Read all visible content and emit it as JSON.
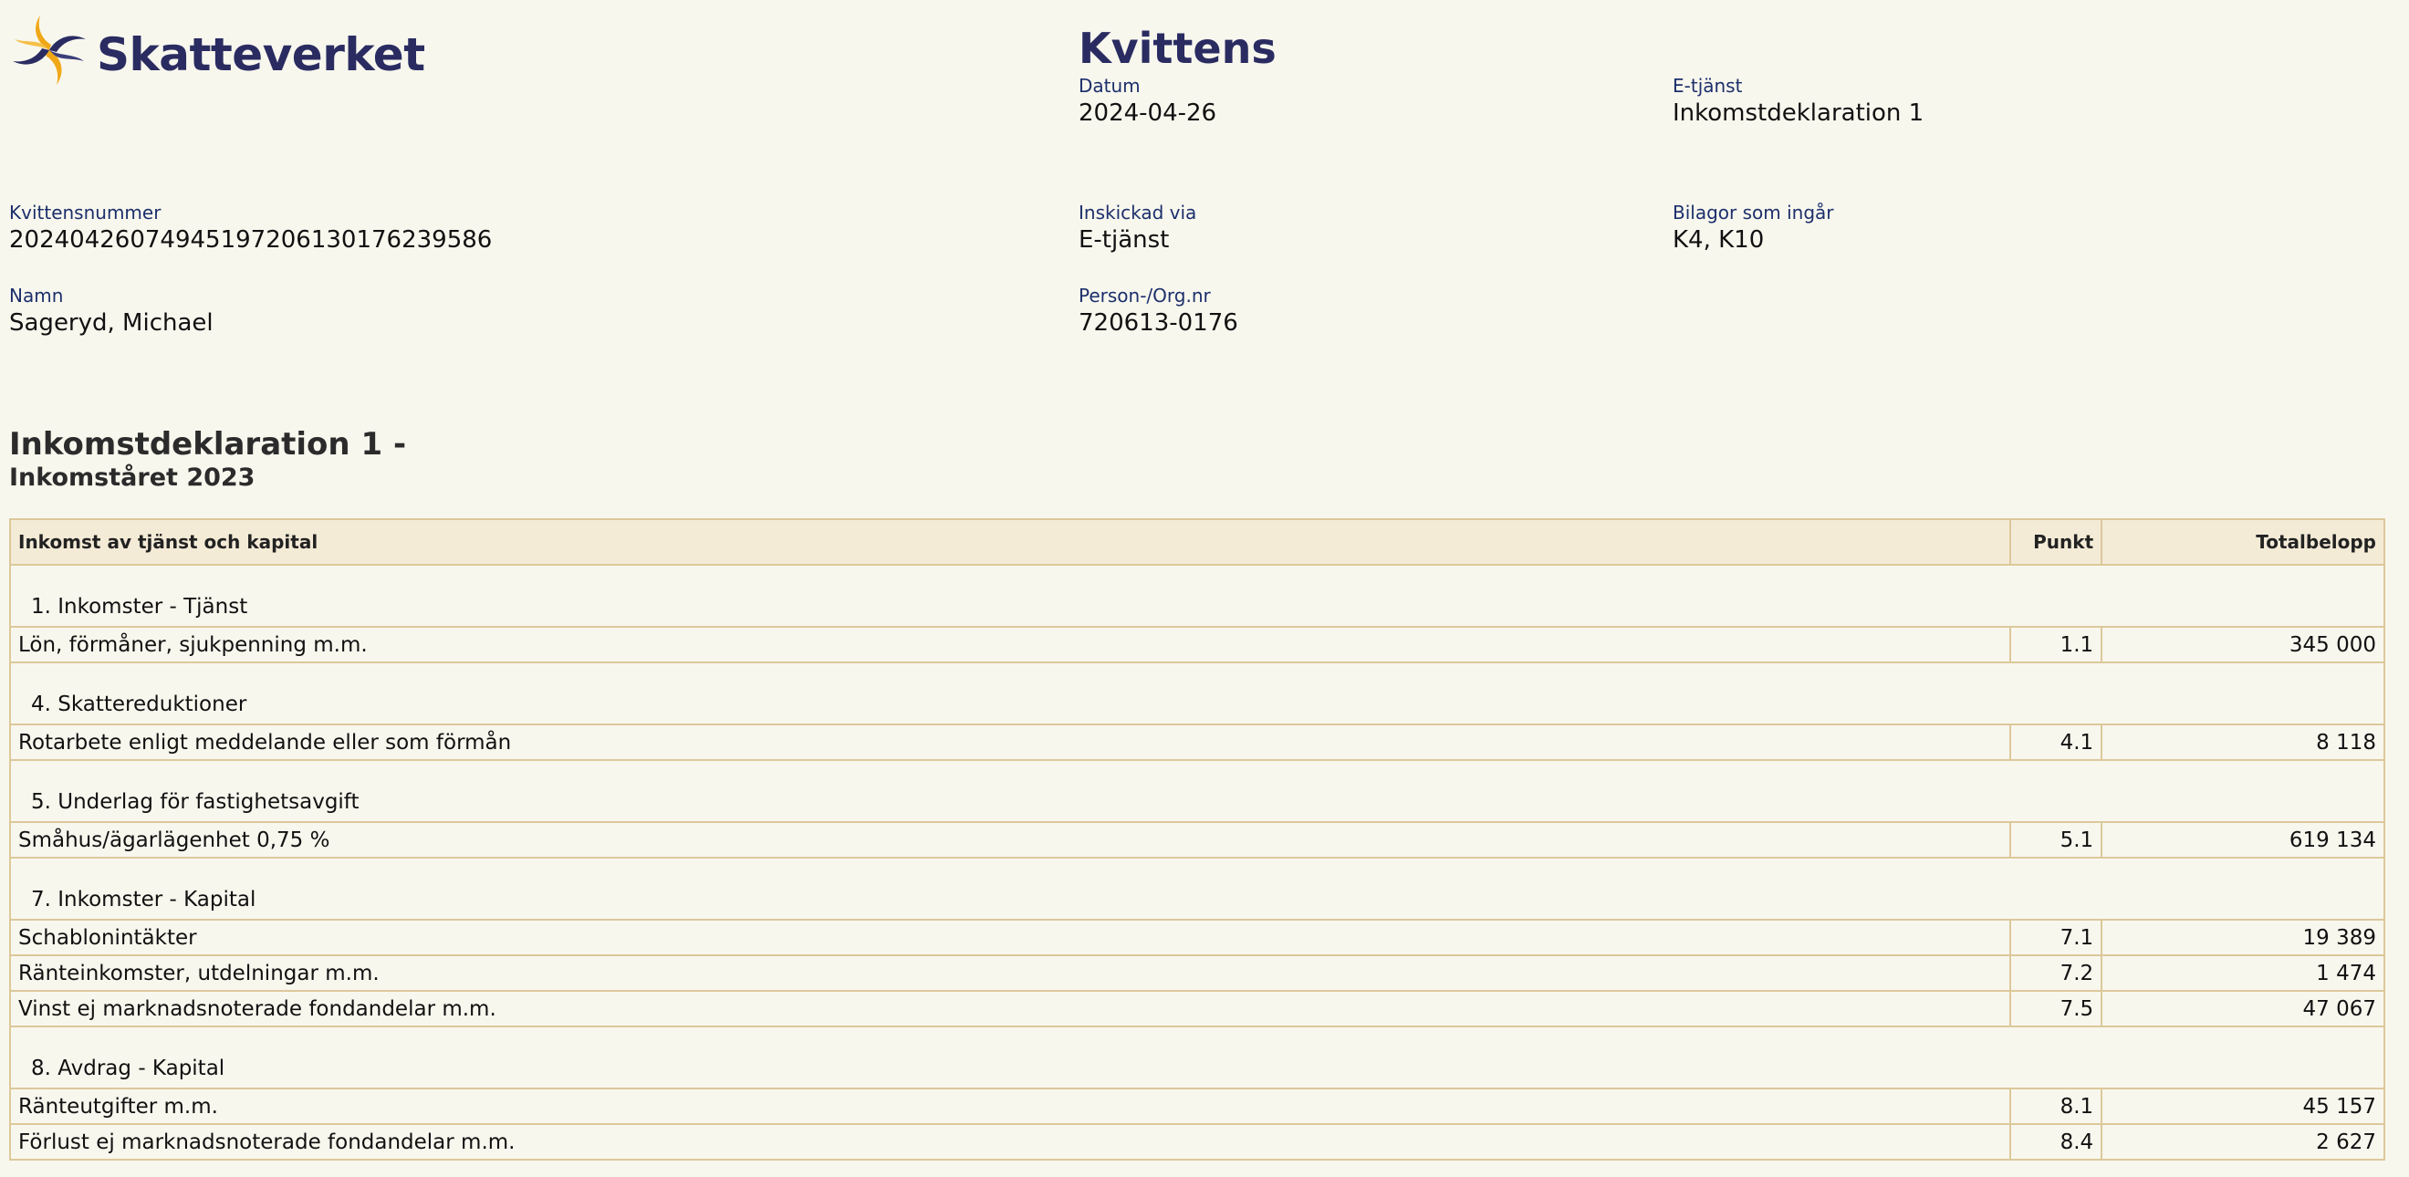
{
  "logo": {
    "text": "Skatteverket",
    "colors": [
      "#f0a818",
      "#2a2c61"
    ]
  },
  "title": "Kvittens",
  "fields": {
    "datum": {
      "label": "Datum",
      "value": "2024-04-26"
    },
    "etjanst": {
      "label": "E-tjänst",
      "value": "Inkomstdeklaration 1"
    },
    "kvittensnummer": {
      "label": "Kvittensnummer",
      "value": "20240426074945197206130176239586"
    },
    "inskickad": {
      "label": "Inskickad via",
      "value": "E-tjänst"
    },
    "bilagor": {
      "label": "Bilagor som ingår",
      "value": "K4, K10"
    },
    "namn": {
      "label": "Namn",
      "value": "Sageryd, Michael"
    },
    "personnr": {
      "label": "Person-/Org.nr",
      "value": "720613-0176"
    }
  },
  "section": {
    "title": "Inkomstdeklaration 1 -",
    "subtitle": "Inkomståret 2023"
  },
  "table": {
    "headers": {
      "desc": "Inkomst av tjänst och kapital",
      "punkt": "Punkt",
      "total": "Totalbelopp"
    },
    "groups": [
      {
        "title": "1. Inkomster - Tjänst",
        "rows": [
          {
            "desc": "Lön, förmåner, sjukpenning m.m.",
            "punkt": "1.1",
            "total": "345 000"
          }
        ]
      },
      {
        "title": "4. Skattereduktioner",
        "rows": [
          {
            "desc": "Rotarbete enligt meddelande eller som förmån",
            "punkt": "4.1",
            "total": "8 118"
          }
        ]
      },
      {
        "title": "5. Underlag för fastighetsavgift",
        "rows": [
          {
            "desc": "Småhus/ägarlägenhet 0,75 %",
            "punkt": "5.1",
            "total": "619 134"
          }
        ]
      },
      {
        "title": "7. Inkomster - Kapital",
        "rows": [
          {
            "desc": "Schablonintäkter",
            "punkt": "7.1",
            "total": "19 389"
          },
          {
            "desc": "Ränteinkomster, utdelningar m.m.",
            "punkt": "7.2",
            "total": "1 474"
          },
          {
            "desc": "Vinst ej marknadsnoterade fondandelar m.m.",
            "punkt": "7.5",
            "total": "47 067"
          }
        ]
      },
      {
        "title": "8. Avdrag - Kapital",
        "rows": [
          {
            "desc": "Ränteutgifter m.m.",
            "punkt": "8.1",
            "total": "45 157"
          },
          {
            "desc": "Förlust ej marknadsnoterade fondandelar m.m.",
            "punkt": "8.4",
            "total": "2 627"
          }
        ]
      }
    ]
  }
}
